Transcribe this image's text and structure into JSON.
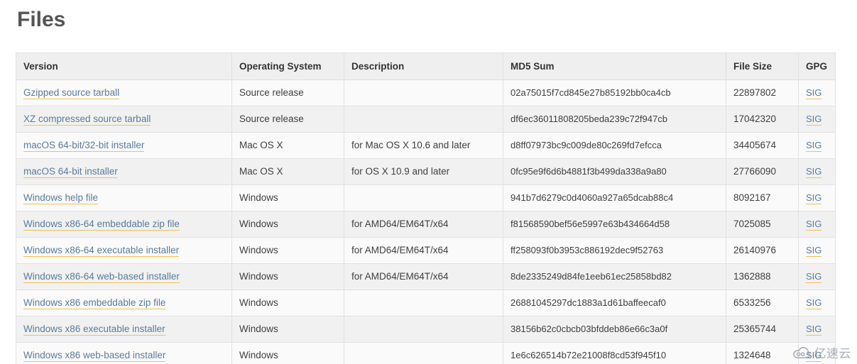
{
  "page": {
    "title": "Files",
    "watermark": {
      "icon": "cloud-icon",
      "text": "亿速云"
    }
  },
  "table": {
    "columns": [
      {
        "key": "version",
        "label": "Version"
      },
      {
        "key": "os",
        "label": "Operating System"
      },
      {
        "key": "description",
        "label": "Description"
      },
      {
        "key": "md5",
        "label": "MD5 Sum"
      },
      {
        "key": "size",
        "label": "File Size"
      },
      {
        "key": "gpg",
        "label": "GPG"
      }
    ],
    "gpg_link_label": "SIG",
    "rows": [
      {
        "version": "Gzipped source tarball",
        "os": "Source release",
        "description": "",
        "md5": "02a75015f7cd845e27b85192bb0ca4cb",
        "size": "22897802",
        "gpg": "SIG"
      },
      {
        "version": "XZ compressed source tarball",
        "os": "Source release",
        "description": "",
        "md5": "df6ec36011808205beda239c72f947cb",
        "size": "17042320",
        "gpg": "SIG"
      },
      {
        "version": "macOS 64-bit/32-bit installer",
        "os": "Mac OS X",
        "description": "for Mac OS X 10.6 and later",
        "md5": "d8ff07973bc9c009de80c269fd7efcca",
        "size": "34405674",
        "gpg": "SIG"
      },
      {
        "version": "macOS 64-bit installer",
        "os": "Mac OS X",
        "description": "for OS X 10.9 and later",
        "md5": "0fc95e9f6d6b4881f3b499da338a9a80",
        "size": "27766090",
        "gpg": "SIG"
      },
      {
        "version": "Windows help file",
        "os": "Windows",
        "description": "",
        "md5": "941b7d6279c0d4060a927a65dcab88c4",
        "size": "8092167",
        "gpg": "SIG"
      },
      {
        "version": "Windows x86-64 embeddable zip file",
        "os": "Windows",
        "description": "for AMD64/EM64T/x64",
        "md5": "f81568590bef56e5997e63b434664d58",
        "size": "7025085",
        "gpg": "SIG"
      },
      {
        "version": "Windows x86-64 executable installer",
        "os": "Windows",
        "description": "for AMD64/EM64T/x64",
        "md5": "ff258093f0b3953c886192dec9f52763",
        "size": "26140976",
        "gpg": "SIG"
      },
      {
        "version": "Windows x86-64 web-based installer",
        "os": "Windows",
        "description": "for AMD64/EM64T/x64",
        "md5": "8de2335249d84fe1eeb61ec25858bd82",
        "size": "1362888",
        "gpg": "SIG"
      },
      {
        "version": "Windows x86 embeddable zip file",
        "os": "Windows",
        "description": "",
        "md5": "26881045297dc1883a1d61baffeecaf0",
        "size": "6533256",
        "gpg": "SIG"
      },
      {
        "version": "Windows x86 executable installer",
        "os": "Windows",
        "description": "",
        "md5": "38156b62c0cbcb03bfddeb86e66c3a0f",
        "size": "25365744",
        "gpg": "SIG"
      },
      {
        "version": "Windows x86 web-based installer",
        "os": "Windows",
        "description": "",
        "md5": "1e6c626514b72e21008f8cd53f945f10",
        "size": "1324648",
        "gpg": "SIG"
      }
    ]
  },
  "colors": {
    "link": "#5a7b9c",
    "link_underline": "#f2c14e",
    "header_bg": "#efefef",
    "row_odd_bg": "#fafafa",
    "row_even_bg": "#f1f1f1",
    "border": "#e1e1e1",
    "title": "#555555",
    "text": "#404040"
  }
}
